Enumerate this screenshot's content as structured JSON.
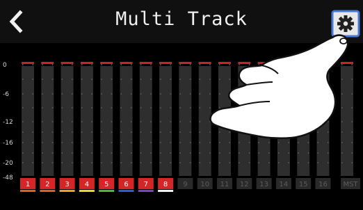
{
  "title": "Multi Track",
  "icons": {
    "back": "chevron-left-icon",
    "settings": "gear-icon"
  },
  "colors": {
    "peak": "#c8222a",
    "meter_bg": "#2e2e2e",
    "grid": "#555555",
    "label_active_bg": "#d42626",
    "label_inactive_bg": "#2a2a2a"
  },
  "scale_labels": [
    "0",
    "-6",
    "-12",
    "-16",
    "-20",
    "-48"
  ],
  "tracks": [
    {
      "label": "1",
      "active": true,
      "color": "#e06020"
    },
    {
      "label": "2",
      "active": true,
      "color": "#e06020"
    },
    {
      "label": "3",
      "active": true,
      "color": "#f0a020"
    },
    {
      "label": "4",
      "active": true,
      "color": "#e8d820"
    },
    {
      "label": "5",
      "active": true,
      "color": "#50b830"
    },
    {
      "label": "6",
      "active": true,
      "color": "#3058e0"
    },
    {
      "label": "7",
      "active": true,
      "color": "#8040c8"
    },
    {
      "label": "8",
      "active": true,
      "color": "#f0f0f0"
    },
    {
      "label": "9",
      "active": false,
      "color": ""
    },
    {
      "label": "10",
      "active": false,
      "color": ""
    },
    {
      "label": "11",
      "active": false,
      "color": ""
    },
    {
      "label": "12",
      "active": false,
      "color": ""
    },
    {
      "label": "13",
      "active": false,
      "color": ""
    },
    {
      "label": "14",
      "active": false,
      "color": ""
    },
    {
      "label": "15",
      "active": false,
      "color": ""
    },
    {
      "label": "16",
      "active": false,
      "color": ""
    },
    {
      "label": "MST",
      "active": false,
      "color": ""
    }
  ]
}
